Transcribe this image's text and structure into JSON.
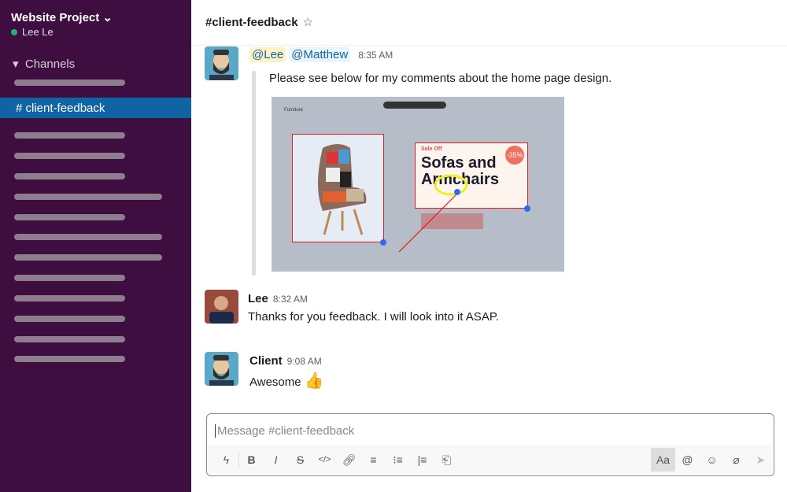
{
  "workspace": {
    "name": "Website Project",
    "user": "Lee Le",
    "status_color": "#2bac76"
  },
  "sidebar": {
    "section": "Channels",
    "selected_channel": "# client-feedback",
    "bg": "#3f0e40",
    "selected_bg": "#1164a3"
  },
  "channel": {
    "title": "#client-feedback",
    "star_icon": "star-outline"
  },
  "messages": [
    {
      "mentions": [
        "@Lee",
        "@Matthew"
      ],
      "time": "8:35 AM",
      "text": "Please see below for my comments about the home page design.",
      "attachment": {
        "brand": "Furniture",
        "sale": "Sale Off",
        "headline1": "Sofas and",
        "headline2": "Armchairs",
        "badge": "-35%"
      }
    },
    {
      "author": "Lee",
      "time": "8:32 AM",
      "text": "Thanks for you feedback. I will look into it ASAP."
    },
    {
      "author": "Client",
      "time": "9:08 AM",
      "text": "Awesome",
      "emoji": "👍"
    }
  ],
  "composer": {
    "placeholder": "Message #client-feedback",
    "format_label": "Aa"
  }
}
